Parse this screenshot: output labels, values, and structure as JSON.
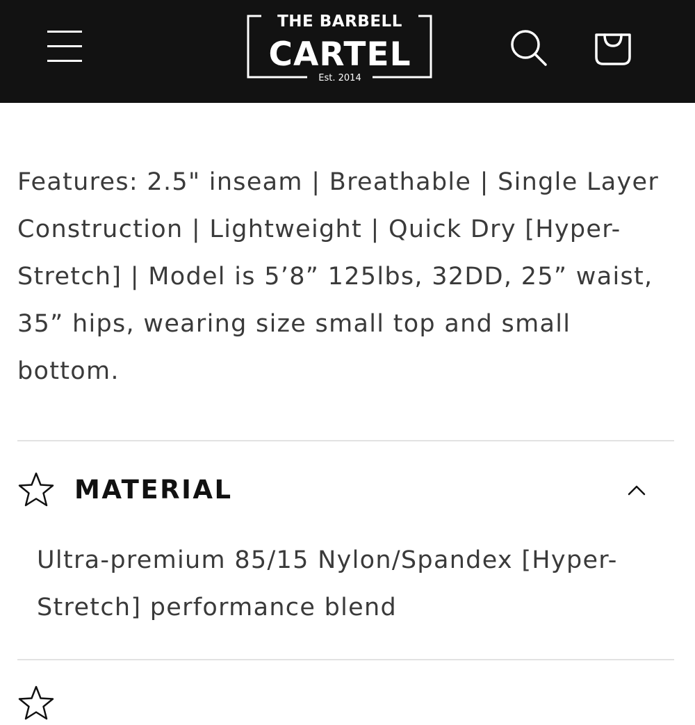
{
  "header": {
    "menu_icon": "hamburger-menu-icon",
    "logo": {
      "line1": "THE BARBELL",
      "line2": "CARTEL",
      "line3": "Est. 2014"
    },
    "search_icon": "search-icon",
    "cart_icon": "cart-icon",
    "background_color": "#121212"
  },
  "product": {
    "features_text": "Features: 2.5\" inseam | Breathable | Single Layer Construction | Lightweight | Quick Dry [Hyper-Stretch] | Model is 5’8” 125lbs, 32DD, 25” waist, 35” hips, wearing size small top and small bottom."
  },
  "accordion": [
    {
      "icon": "star-icon",
      "title": "MATERIAL",
      "expanded": true,
      "body": "Ultra-premium 85/15 Nylon/Spandex [Hyper-Stretch] performance blend"
    }
  ]
}
